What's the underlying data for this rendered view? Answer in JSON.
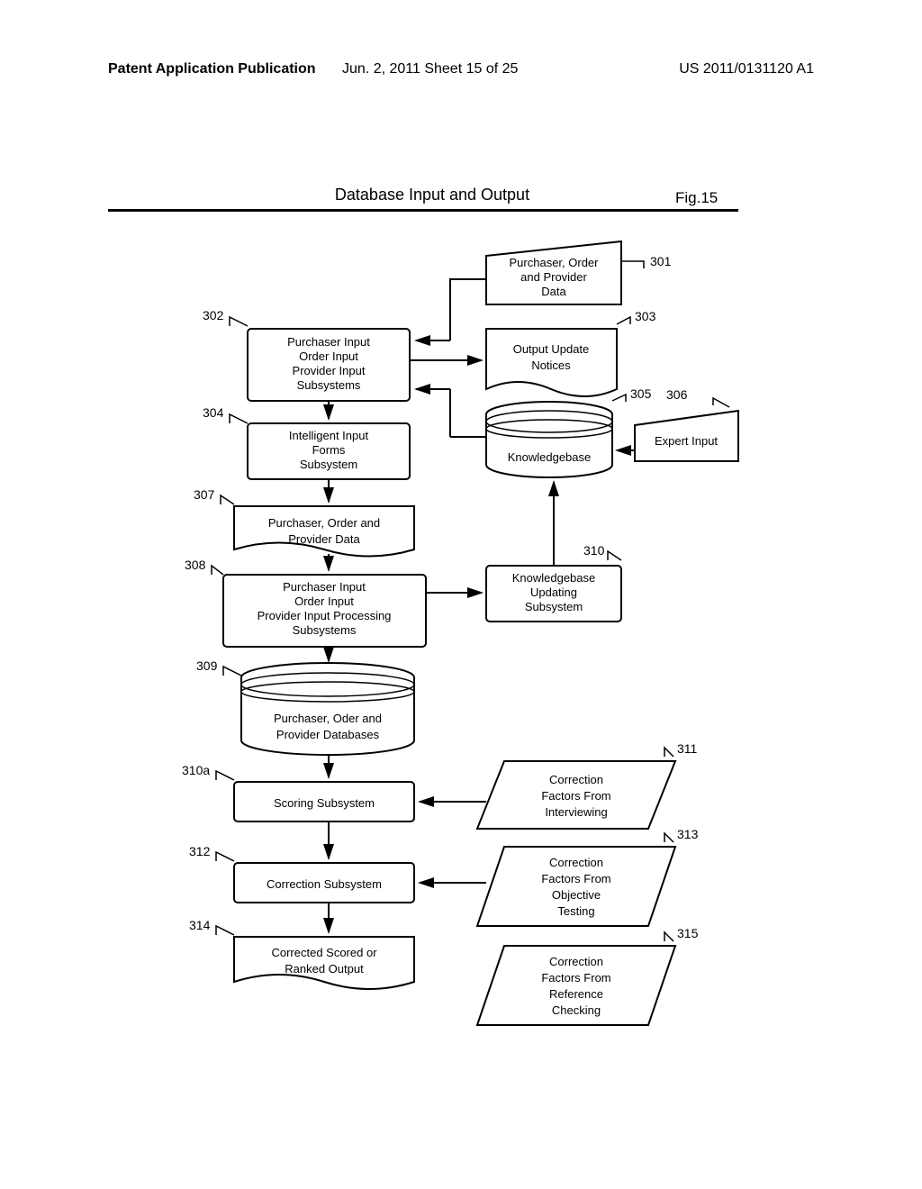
{
  "header": {
    "left": "Patent Application Publication",
    "mid": "Jun. 2, 2011  Sheet 15 of 25",
    "right": "US 2011/0131120 A1"
  },
  "title": "Database Input and Output",
  "fig": "Fig.15",
  "refs": {
    "r301": "301",
    "r302": "302",
    "r303": "303",
    "r304": "304",
    "r305": "305",
    "r306": "306",
    "r307": "307",
    "r308": "308",
    "r309": "309",
    "r310": "310",
    "r310a": "310a",
    "r311": "311",
    "r312": "312",
    "r313": "313",
    "r314": "314",
    "r315": "315"
  },
  "nodes": {
    "n301_l1": "Purchaser, Order",
    "n301_l2": "and Provider",
    "n301_l3": "Data",
    "n302_l1": "Purchaser Input",
    "n302_l2": "Order Input",
    "n302_l3": "Provider Input",
    "n302_l4": "Subsystems",
    "n303_l1": "Output Update",
    "n303_l2": "Notices",
    "n304_l1": "Intelligent Input",
    "n304_l2": "Forms",
    "n304_l3": "Subsystem",
    "n305": "Knowledgebase",
    "n306": "Expert Input",
    "n307_l1": "Purchaser, Order and",
    "n307_l2": "Provider Data",
    "n308_l1": "Purchaser Input",
    "n308_l2": "Order Input",
    "n308_l3": "Provider Input Processing",
    "n308_l4": "Subsystems",
    "n309_l1": "Purchaser, Oder and",
    "n309_l2": "Provider Databases",
    "n310_l1": "Knowledgebase",
    "n310_l2": "Updating",
    "n310_l3": "Subsystem",
    "n310a": "Scoring Subsystem",
    "n311_l1": "Correction",
    "n311_l2": "Factors From",
    "n311_l3": "Interviewing",
    "n312": "Correction Subsystem",
    "n313_l1": "Correction",
    "n313_l2": "Factors From",
    "n313_l3": "Objective",
    "n313_l4": "Testing",
    "n314_l1": "Corrected Scored or",
    "n314_l2": "Ranked Output",
    "n315_l1": "Correction",
    "n315_l2": "Factors From",
    "n315_l3": "Reference",
    "n315_l4": "Checking"
  }
}
